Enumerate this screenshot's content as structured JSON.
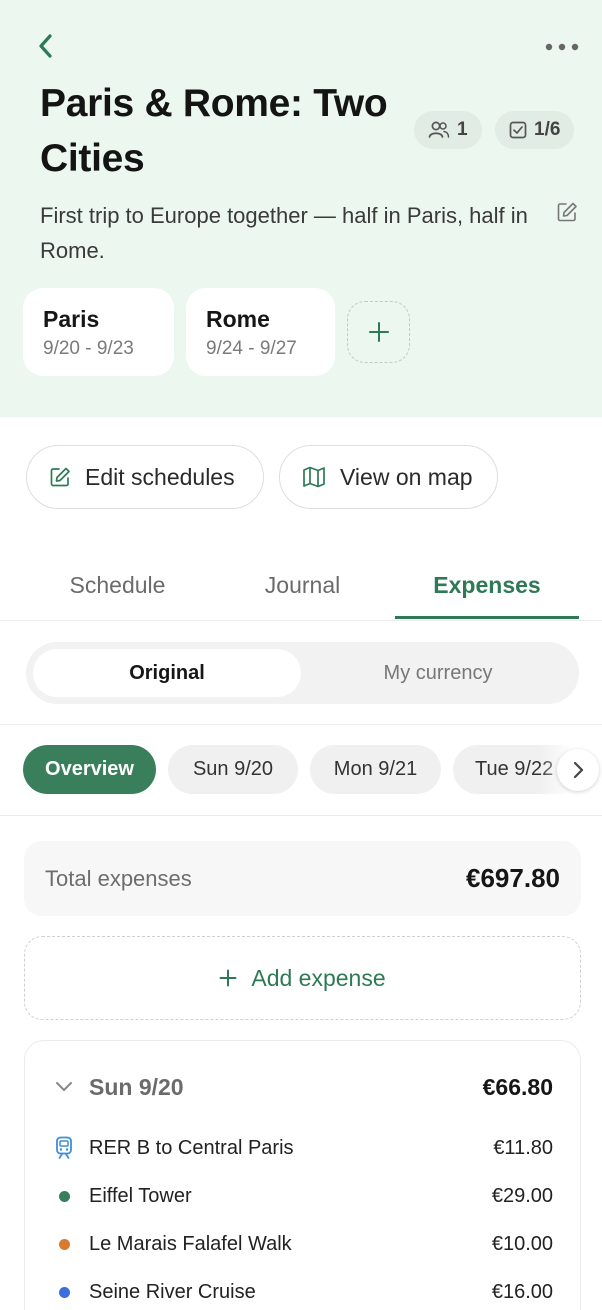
{
  "header": {
    "title": "Paris & Rome: Two Cities",
    "travelers_count": "1",
    "tasks_progress": "1/6",
    "description": "First trip to Europe together — half in Paris, half in Rome.",
    "icons": {
      "back": "chevron-left-icon",
      "more": "more-horizontal-icon",
      "travelers": "people-icon",
      "tasks": "checkbox-icon",
      "edit": "edit-icon"
    }
  },
  "cities": [
    {
      "name": "Paris",
      "dates": "9/20 - 9/23"
    },
    {
      "name": "Rome",
      "dates": "9/24 - 9/27"
    }
  ],
  "actions": {
    "edit_schedules": "Edit schedules",
    "view_on_map": "View on map"
  },
  "tabs": [
    {
      "label": "Schedule",
      "active": false
    },
    {
      "label": "Journal",
      "active": false
    },
    {
      "label": "Expenses",
      "active": true
    }
  ],
  "currency_toggle": {
    "options": [
      "Original",
      "My currency"
    ],
    "selected": "Original"
  },
  "day_chips": [
    {
      "label": "Overview",
      "active": true
    },
    {
      "label": "Sun 9/20",
      "active": false
    },
    {
      "label": "Mon 9/21",
      "active": false
    },
    {
      "label": "Tue 9/22",
      "active": false
    }
  ],
  "expenses": {
    "total_label": "Total expenses",
    "total_value": "€697.80",
    "add_label": "Add expense",
    "day_group": {
      "title": "Sun 9/20",
      "total": "€66.80",
      "items": [
        {
          "name": "RER B to Central Paris",
          "amount": "€11.80",
          "marker": "train-icon",
          "color": "#3b8fd9"
        },
        {
          "name": "Eiffel Tower",
          "amount": "€29.00",
          "marker": "dot",
          "color": "#3a7f5c"
        },
        {
          "name": "Le Marais Falafel Walk",
          "amount": "€10.00",
          "marker": "dot",
          "color": "#d97b2b"
        },
        {
          "name": "Seine River Cruise",
          "amount": "€16.00",
          "marker": "dot",
          "color": "#3b6fe0"
        }
      ]
    }
  },
  "colors": {
    "accent": "#2e7a56",
    "hero_bg": "#ebf7ef",
    "chip_active": "#3a7f5c"
  }
}
